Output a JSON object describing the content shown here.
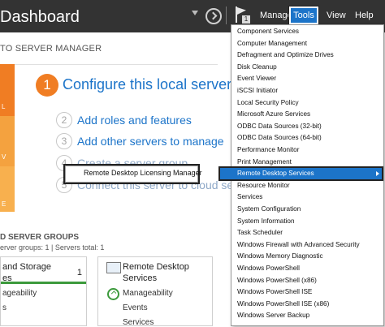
{
  "header": {
    "title": "Dashboard",
    "menu": {
      "manage": "Manage",
      "tools": "Tools",
      "view": "View",
      "help": "Help"
    },
    "notification_count": "1"
  },
  "welcome": {
    "section_title": "TO SERVER MANAGER",
    "side_labels": [
      "L",
      "V",
      "E"
    ],
    "steps": [
      {
        "num": "1",
        "label": "Configure this local server"
      },
      {
        "num": "2",
        "label": "Add roles and features"
      },
      {
        "num": "3",
        "label": "Add other servers to manage"
      },
      {
        "num": "4",
        "label": "Create a server group"
      },
      {
        "num": "5",
        "label": "Connect this server to cloud serv"
      }
    ],
    "context_item": "Remote Desktop Licensing Manager"
  },
  "groups": {
    "title": "D SERVER GROUPS",
    "subtitle": "erver groups: 1  |  Servers total: 1",
    "cards": [
      {
        "title_lines": [
          "and Storage",
          "es"
        ],
        "count": "1",
        "rows": [
          "ageability",
          "s"
        ]
      },
      {
        "title_lines": [
          "Remote Desktop",
          "Services"
        ],
        "count": "",
        "rows": [
          "Manageability",
          "Events",
          "Services"
        ]
      }
    ]
  },
  "tools_menu": {
    "items": [
      "Component Services",
      "Computer Management",
      "Defragment and Optimize Drives",
      "Disk Cleanup",
      "Event Viewer",
      "iSCSI Initiator",
      "Local Security Policy",
      "Microsoft Azure Services",
      "ODBC Data Sources (32-bit)",
      "ODBC Data Sources (64-bit)",
      "Performance Monitor",
      "Print Management",
      "Remote Desktop Services",
      "Resource Monitor",
      "Services",
      "System Configuration",
      "System Information",
      "Task Scheduler",
      "Windows Firewall with Advanced Security",
      "Windows Memory Diagnostic",
      "Windows PowerShell",
      "Windows PowerShell (x86)",
      "Windows PowerShell ISE",
      "Windows PowerShell ISE (x86)",
      "Windows Server Backup"
    ],
    "selected": "Remote Desktop Services"
  },
  "colors": {
    "accent": "#1c74c9",
    "orange": "#f07d23",
    "topbar": "#333333",
    "ok_green": "#3c9a3c"
  },
  "icons": [
    "chevron-down-icon",
    "refresh-icon",
    "flag-icon",
    "submenu-arrow-icon",
    "ok-check-icon",
    "remote-desktop-icon"
  ]
}
